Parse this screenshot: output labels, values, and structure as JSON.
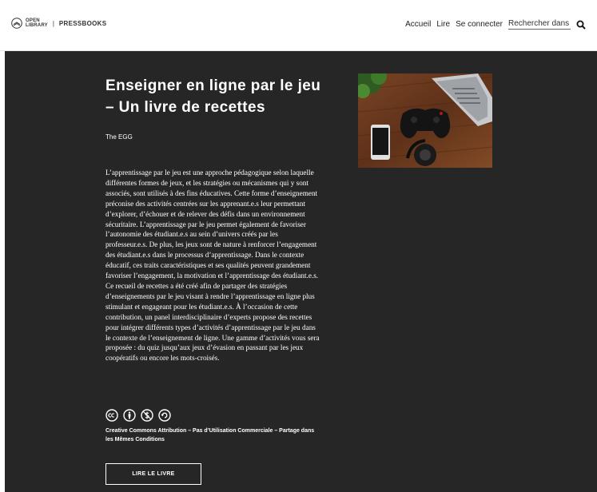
{
  "header": {
    "logo": {
      "line1": "OPEN",
      "line2": "LIBRARY",
      "separator": "|",
      "brand": "PRESSBOOKS"
    },
    "nav": [
      {
        "label": "Accueil"
      },
      {
        "label": "Lire"
      },
      {
        "label": "Se connecter"
      }
    ],
    "search": {
      "placeholder": "Rechercher dans le livre",
      "icon": "search-icon"
    }
  },
  "book": {
    "title": "Enseigner en ligne par le jeu – Un livre de recettes",
    "author": "The EGG",
    "description": "L’apprentissage par le jeu est une approche pédagogique selon laquelle différentes formes de jeux, et les stratégies ou mécanismes qui y sont associés, sont utilisés à des fins éducatives. Cette forme d’enseignement préconise des activités centrées sur les apprenant.e.s leur permettant d’explorer, d’échouer et de relever des défis dans un environnement sécuritaire. L’apprentissage par le jeu permet également de favoriser l’autonomie des étudiant.e.s au sein d’univers créés par les professeur.e.s. De plus, les jeux sont de nature à renforcer l’engagement des étudiant.e.s dans le processus d’apprentissage. Dans le contexte éducatif, ces traits caractéristiques et ses qualités peuvent grandement favoriser l’engagement, la motivation et l’apprentissage des étudiant.e.s. Ce recueil de recettes a été créé afin de partager des stratégies d’enseignements par le jeu visant à rendre l’apprentissage en ligne plus stimulant et engageant pour les étudiant.e.s. À l’occasion de cette contribution, un panel interdisciplinaire d’experts propose des recettes pour intégrer différents types d’activités d’apprentissage par le jeu dans le contexte de l’enseignement de ligne. Une gamme d’activités vous sera proposée : du quiz jusqu’aux jeux d’évasion en passant par les jeux coopératifs ou encore les mots-croisés.",
    "license_icons": [
      "cc-icon",
      "attribution-icon",
      "noncommercial-icon",
      "sharealike-icon"
    ],
    "license": "Creative Commons Attribution – Pas d’Utilisation Commerciale – Partage dans les Mêmes Conditions",
    "read_button": "LIRE LE LIVRE"
  },
  "colors": {
    "hero_bg": "#262626",
    "text_on_dark": "#ffffff",
    "header_bg": "#ffffff"
  }
}
